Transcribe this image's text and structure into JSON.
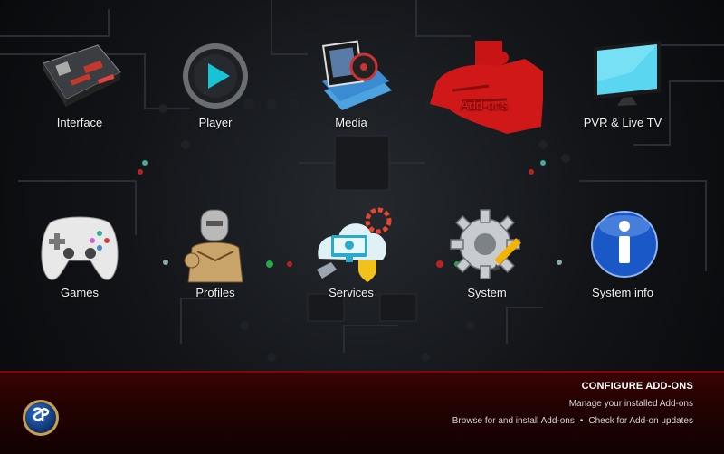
{
  "menu": {
    "items": [
      {
        "label": "Interface",
        "icon": "motherboard-icon"
      },
      {
        "label": "Player",
        "icon": "play-icon"
      },
      {
        "label": "Media",
        "icon": "media-film-icon"
      },
      {
        "label": "Add-ons",
        "icon": "puzzle-hand-icon",
        "active": true
      },
      {
        "label": "PVR & Live TV",
        "icon": "tv-icon"
      },
      {
        "label": "Games",
        "icon": "gamepad-icon"
      },
      {
        "label": "Profiles",
        "icon": "profile-robot-icon"
      },
      {
        "label": "Services",
        "icon": "services-icon"
      },
      {
        "label": "System",
        "icon": "gear-pencil-icon"
      },
      {
        "label": "System info",
        "icon": "info-icon"
      }
    ]
  },
  "info": {
    "title": "CONFIGURE ADD-ONS",
    "subtitle": "Manage your installed Add-ons",
    "link_browse": "Browse for and install Add-ons",
    "separator": "•",
    "link_updates": "Check for Add-on updates"
  },
  "colors": {
    "accent": "#e31b1b",
    "bar": "#3a0303"
  }
}
